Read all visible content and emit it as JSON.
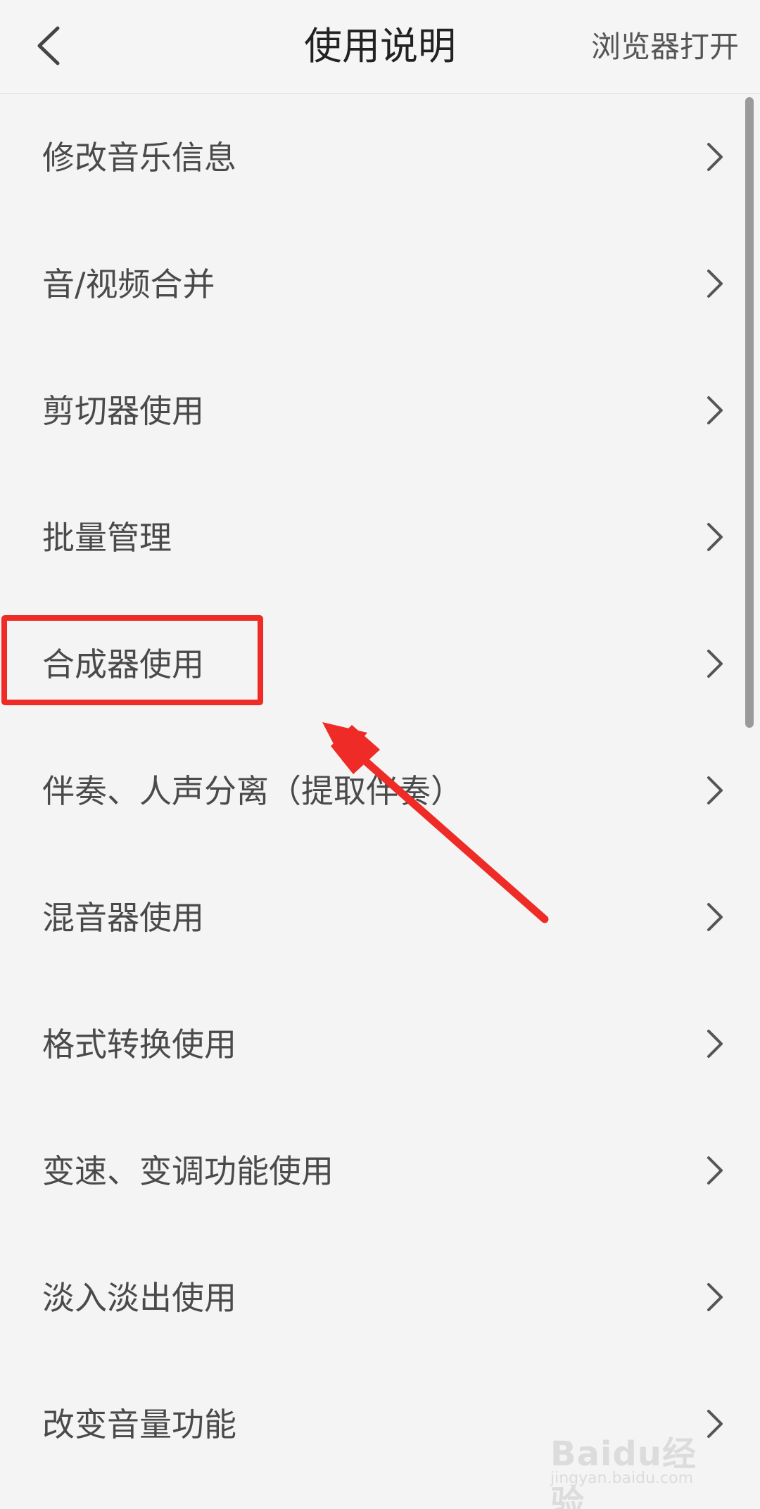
{
  "header": {
    "title": "使用说明",
    "open_in_browser": "浏览器打开"
  },
  "list": {
    "items": [
      {
        "label": "修改音乐信息"
      },
      {
        "label": "音/视频合并"
      },
      {
        "label": "剪切器使用"
      },
      {
        "label": "批量管理"
      },
      {
        "label": "合成器使用"
      },
      {
        "label": "伴奏、人声分离（提取伴奏）"
      },
      {
        "label": "混音器使用"
      },
      {
        "label": "格式转换使用"
      },
      {
        "label": "变速、变调功能使用"
      },
      {
        "label": "淡入淡出使用"
      },
      {
        "label": "改变音量功能"
      }
    ]
  },
  "annotation": {
    "highlight_color": "#ee2b26",
    "highlighted_item": "合成器使用"
  },
  "watermark": {
    "logo": "Baidu经验",
    "sub": "jingyan.baidu.com"
  }
}
